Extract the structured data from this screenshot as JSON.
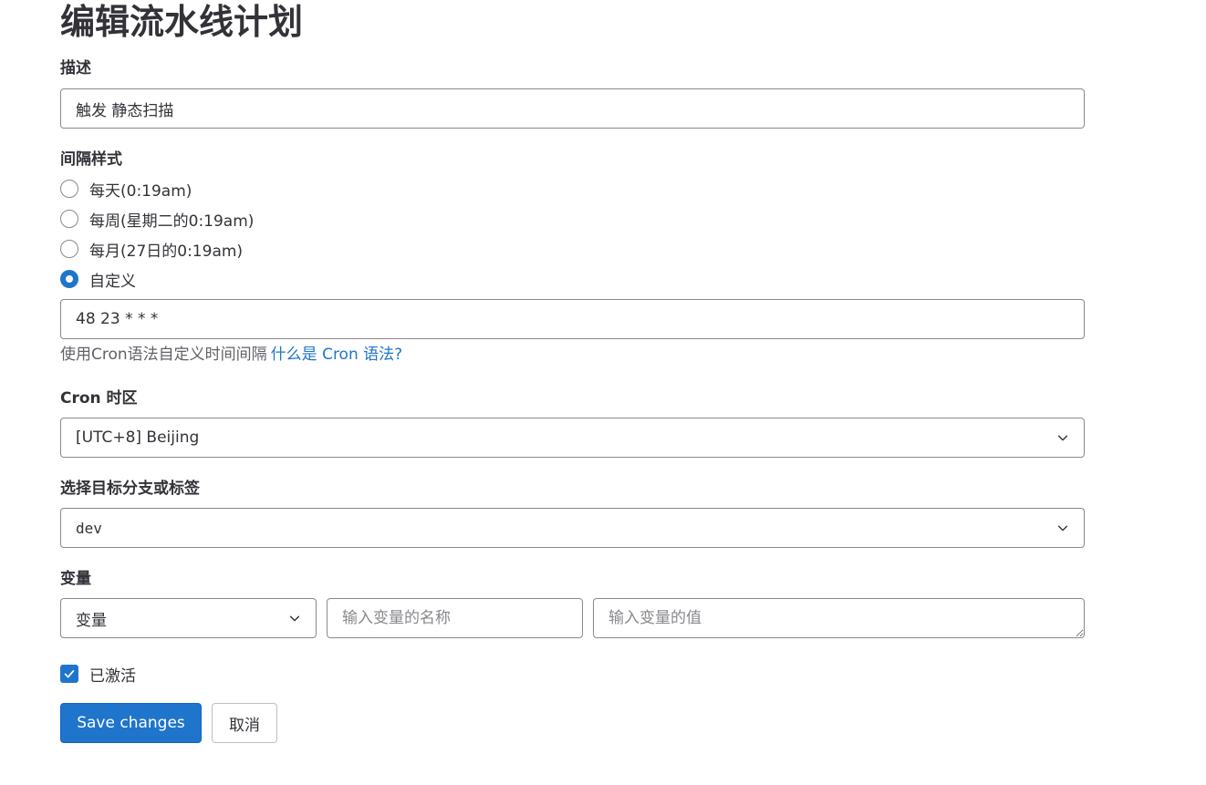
{
  "page": {
    "title": "编辑流水线计划"
  },
  "description": {
    "label": "描述",
    "value": "触发 静态扫描"
  },
  "interval": {
    "label": "间隔样式",
    "options": [
      {
        "label": "每天(0:19am)",
        "checked": false
      },
      {
        "label": "每周(星期二的0:19am)",
        "checked": false
      },
      {
        "label": "每月(27日的0:19am)",
        "checked": false
      },
      {
        "label": "自定义",
        "checked": true
      }
    ],
    "cron_value": "48 23 * * *",
    "help_text": "使用Cron语法自定义时间间隔",
    "help_link": "什么是 Cron 语法?"
  },
  "timezone": {
    "label": "Cron 时区",
    "selected": "[UTC+8] Beijing"
  },
  "target_ref": {
    "label": "选择目标分支或标签",
    "selected": "dev"
  },
  "variables": {
    "label": "变量",
    "type_selected": "变量",
    "name_placeholder": "输入变量的名称",
    "value_placeholder": "输入变量的值"
  },
  "active": {
    "label": "已激活",
    "checked": true
  },
  "actions": {
    "save_label": "Save changes",
    "cancel_label": "取消"
  },
  "colors": {
    "accent": "#1f75cb",
    "text": "#333238",
    "muted": "#626168",
    "border": "#89888d"
  },
  "icons": {
    "select_chevron": "chevron-down-icon",
    "checkbox_mark": "check-icon"
  }
}
